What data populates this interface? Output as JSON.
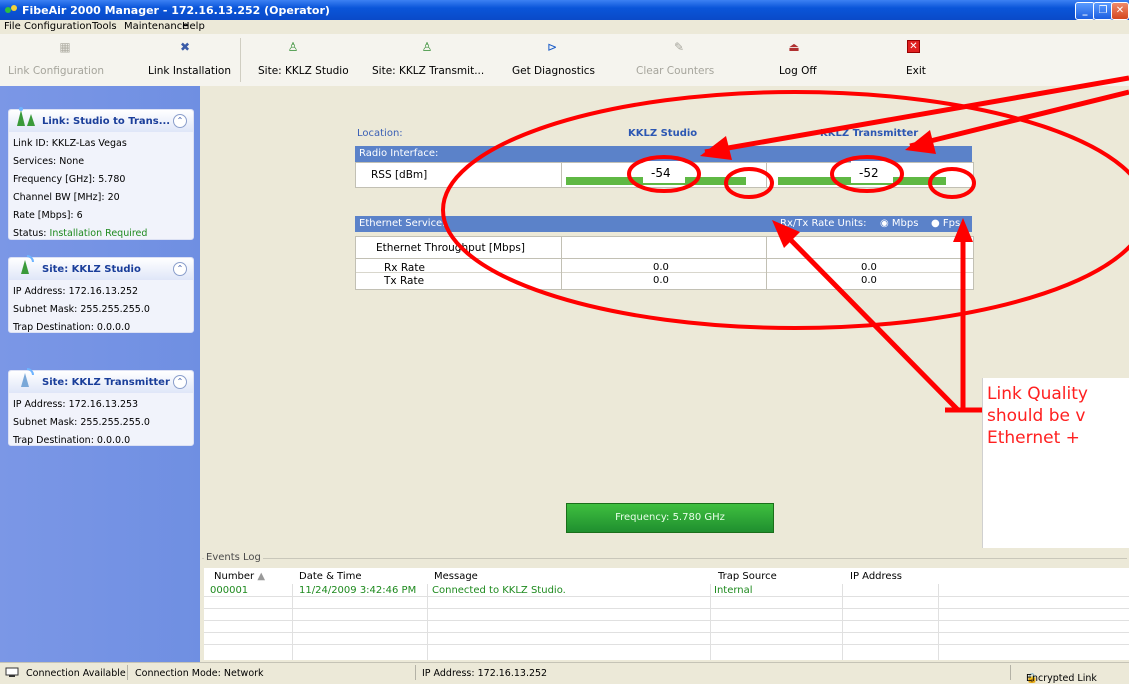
{
  "window": {
    "title": "FibeAir 2000 Manager - 172.16.13.252 (Operator)",
    "controls": [
      "minimize-icon",
      "restore-icon",
      "close-icon"
    ]
  },
  "menu": [
    "File",
    "Configuration",
    "Tools",
    "Maintenance",
    "Help"
  ],
  "toolbar": {
    "link_config": "Link Configuration",
    "link_install": "Link Installation",
    "site_studio": "Site: KKLZ Studio",
    "site_transmit": "Site: KKLZ Transmit...",
    "diagnostics": "Get Diagnostics",
    "clear": "Clear Counters",
    "logoff": "Log Off",
    "exit": "Exit"
  },
  "link_card": {
    "title": "Link: Studio to Trans...",
    "rows": [
      "Link ID:  KKLZ-Las Vegas",
      "Services:  None",
      "Frequency [GHz]:  5.780",
      "Channel BW [MHz]:  20",
      "Rate [Mbps]:  6"
    ],
    "status_label": "Status:",
    "status_value": "Installation Required"
  },
  "site_studio": {
    "title": "Site: KKLZ Studio",
    "rows": [
      "IP Address:  172.16.13.252",
      "Subnet Mask:  255.255.255.0",
      "Trap Destination:  0.0.0.0"
    ]
  },
  "site_transmitter": {
    "title": "Site: KKLZ Transmitter",
    "rows": [
      "IP Address:  172.16.13.253",
      "Subnet Mask:  255.255.255.0",
      "Trap Destination:  0.0.0.0"
    ]
  },
  "main": {
    "location_label": "Location:",
    "site1": "KKLZ Studio",
    "site2": "KKLZ Transmitter",
    "radio_interface": "Radio Interface:",
    "rss_label": "RSS [dBm]",
    "rss1": "-54",
    "rss2": "-52",
    "ethernet_service": "Ethernet Service:",
    "rate_units": "Rx/Tx Rate Units:",
    "unit_mbps": "Mbps",
    "unit_fps": "Fps",
    "throughput": "Ethernet Throughput [Mbps]",
    "rx_rate": "Rx Rate",
    "tx_rate": "Tx Rate",
    "rx1": "0.0",
    "rx2": "0.0",
    "tx1": "0.0",
    "tx2": "0.0",
    "frequency_button": "Frequency: 5.780 GHz"
  },
  "events": {
    "title": "Events Log",
    "columns": [
      "Number",
      "Date & Time",
      "Message",
      "Trap Source",
      "IP Address"
    ],
    "rows": [
      {
        "number": "000001",
        "datetime": "11/24/2009 3:42:46 PM",
        "message": "Connected to KKLZ Studio.",
        "source": "Internal",
        "ip": ""
      }
    ]
  },
  "status": {
    "connection": "Connection Available",
    "mode": "Connection Mode: Network",
    "ip": "IP Address: 172.16.13.252",
    "encrypted": "Encrypted Link"
  },
  "annotation": {
    "lines": [
      "Link Quality",
      "should be v",
      "Ethernet +"
    ]
  }
}
